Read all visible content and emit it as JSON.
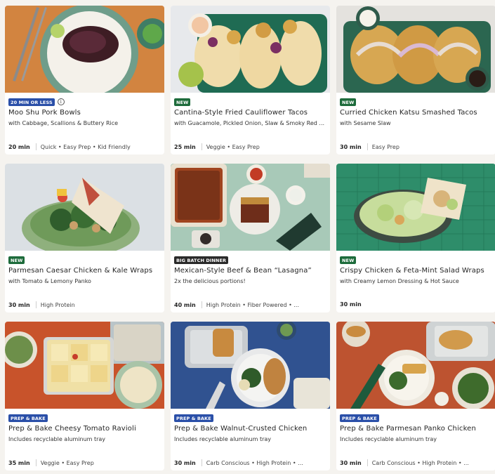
{
  "recipes": [
    {
      "badge": "20 MIN OR LESS",
      "badge_color": "#2a4fa8",
      "has_info": true,
      "title": "Moo Shu Pork Bowls",
      "subtitle": "with Cabbage, Scallions & Buttery Rice",
      "time": "20 min",
      "tags": "Quick • Easy Prep • Kid Friendly"
    },
    {
      "badge": "NEW",
      "badge_color": "#1d6b3b",
      "has_info": false,
      "title": "Cantina-Style Fried Cauliflower Tacos",
      "subtitle": "with Guacamole, Pickled Onion, Slaw & Smoky Red ...",
      "time": "25 min",
      "tags": "Veggie • Easy Prep"
    },
    {
      "badge": "NEW",
      "badge_color": "#1d6b3b",
      "has_info": false,
      "title": "Curried Chicken Katsu Smashed Tacos",
      "subtitle": "with Sesame Slaw",
      "time": "30 min",
      "tags": "Easy Prep"
    },
    {
      "badge": "NEW",
      "badge_color": "#1d6b3b",
      "has_info": false,
      "title": "Parmesan Caesar Chicken & Kale Wraps",
      "subtitle": "with Tomato & Lemony Panko",
      "time": "30 min",
      "tags": "High Protein"
    },
    {
      "badge": "BIG BATCH DINNER",
      "badge_color": "#2a2a2a",
      "has_info": false,
      "title": "Mexican-Style Beef & Bean “Lasagna”",
      "subtitle": "2x the delicious portions!",
      "time": "40 min",
      "tags": "High Protein • Fiber Powered • ..."
    },
    {
      "badge": "NEW",
      "badge_color": "#1d6b3b",
      "has_info": false,
      "title": "Crispy Chicken & Feta-Mint Salad Wraps",
      "subtitle": "with Creamy Lemon Dressing & Hot Sauce",
      "time": "30 min",
      "tags": ""
    },
    {
      "badge": "PREP & BAKE",
      "badge_color": "#2a4fa8",
      "has_info": false,
      "title": "Prep & Bake Cheesy Tomato Ravioli",
      "subtitle": "Includes recyclable aluminum tray",
      "time": "35 min",
      "tags": "Veggie • Easy Prep"
    },
    {
      "badge": "PREP & BAKE",
      "badge_color": "#2a4fa8",
      "has_info": false,
      "title": "Prep & Bake Walnut-Crusted Chicken",
      "subtitle": "Includes recyclable aluminum tray",
      "time": "30 min",
      "tags": "Carb Conscious • High Protein • ..."
    },
    {
      "badge": "PREP & BAKE",
      "badge_color": "#2a4fa8",
      "has_info": false,
      "title": "Prep & Bake Parmesan Panko Chicken",
      "subtitle": "Includes recyclable aluminum tray",
      "time": "30 min",
      "tags": "Carb Conscious • High Protein • ..."
    }
  ]
}
